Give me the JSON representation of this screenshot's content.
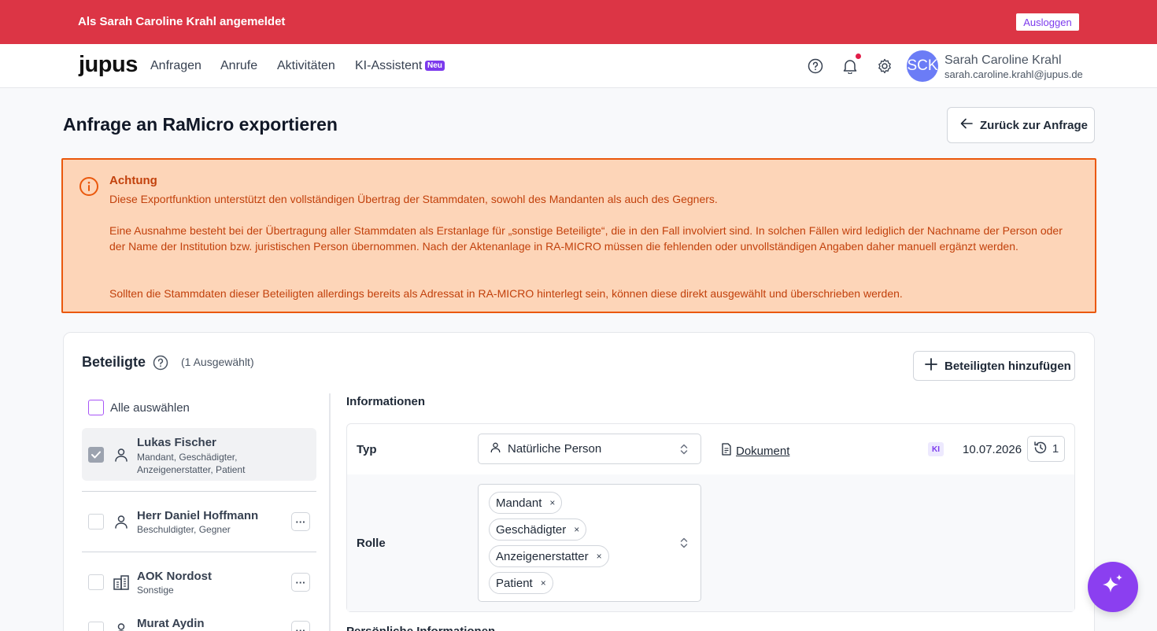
{
  "banner": {
    "text": "Als Sarah Caroline Krahl angemeldet",
    "logout": "Ausloggen"
  },
  "nav": {
    "logo": "jupus",
    "links": [
      "Anfragen",
      "Anrufe",
      "Aktivitäten",
      "KI-Assistent"
    ],
    "new_badge": "Neu",
    "icons": [
      "help-icon",
      "bell-icon",
      "gear-icon"
    ],
    "user": {
      "initials": "SCK",
      "name": "Sarah Caroline Krahl",
      "email": "sarah.caroline.krahl@jupus.de"
    }
  },
  "page": {
    "title": "Anfrage an RaMicro exportieren",
    "back_label": "Zurück zur Anfrage"
  },
  "alert": {
    "title": "Achtung",
    "p1": "Diese Exportfunktion unterstützt den vollständigen Übertrag der Stammdaten, sowohl des Mandanten als auch des Gegners.",
    "p2": "Eine Ausnahme besteht bei der Übertragung aller Stammdaten als Erstanlage für „sonstige Beteiligte“, die in den Fall involviert sind. In solchen Fällen wird lediglich der Nachname der Person oder der Name der Institution bzw. juristischen Person übernommen. Nach der Aktenanlage in RA-MICRO müssen die fehlenden oder unvollständigen Angaben daher manuell ergänzt werden.",
    "p3": "Sollten die Stammdaten dieser Beteiligten allerdings bereits als Adressat in RA-MICRO hinterlegt sein, können diese direkt ausgewählt und überschrieben werden."
  },
  "participants": {
    "title": "Beteiligte",
    "selected": "(1 Ausgewählt)",
    "add_label": "Beteiligten hinzufügen",
    "select_all": "Alle auswählen",
    "items": [
      {
        "name": "Lukas Fischer",
        "role_line1": "Mandant, Geschädigter,",
        "role_line2": "Anzeigenerstatter, Patient",
        "checked": true,
        "icon": "person-icon"
      },
      {
        "name": "Herr Daniel Hoffmann",
        "role_line1": "Beschuldigter, Gegner",
        "checked": false,
        "icon": "person-icon"
      },
      {
        "name": "AOK Nordost",
        "role_line1": "Sonstige",
        "checked": false,
        "icon": "building-icon"
      },
      {
        "name": "Murat Aydin",
        "checked": false,
        "icon": "person-icon"
      }
    ],
    "more": "···"
  },
  "info": {
    "title": "Informationen",
    "typ_label": "Typ",
    "typ_value": "Natürliche Person",
    "doc_link": "Dokument",
    "ki_badge": "KI",
    "date": "10.07.2026",
    "history_count": "1",
    "rolle_label": "Rolle",
    "roles": [
      "Mandant",
      "Geschädigter",
      "Anzeigenerstatter",
      "Patient"
    ],
    "remove": "×",
    "next_section": "Persönliche Informationen"
  },
  "colors": {
    "banner": "#dc3545",
    "accent": "#7c3aed",
    "alert_bg": "#fdd5b8",
    "alert_fg": "#c2410c"
  }
}
